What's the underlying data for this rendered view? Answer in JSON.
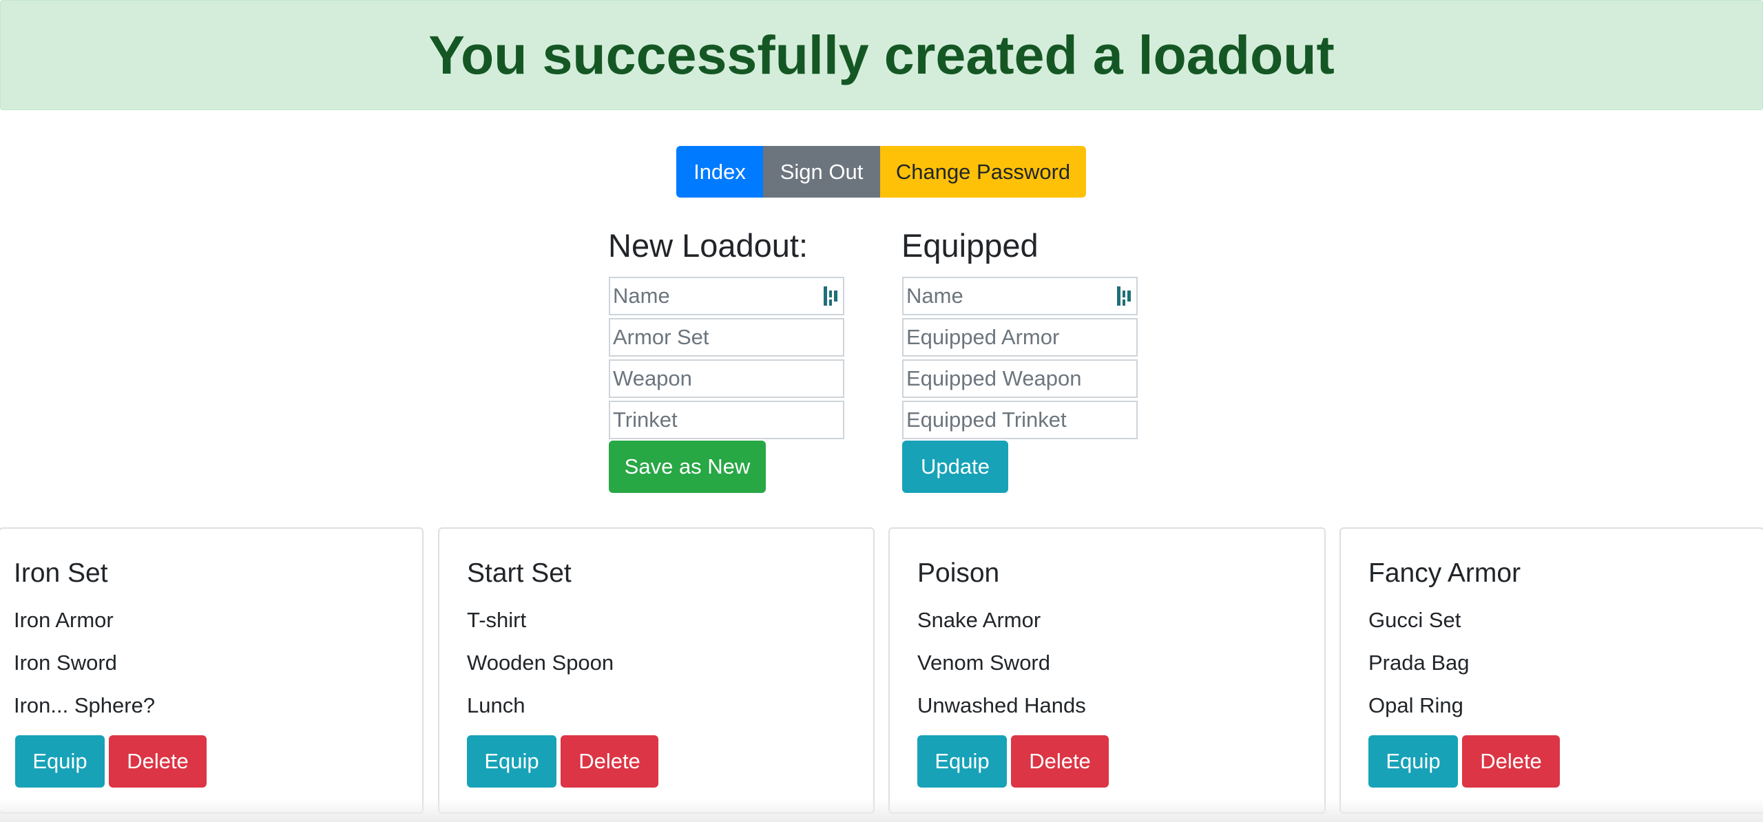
{
  "alert": {
    "message": "You successfully created a loadout",
    "color": "#155724",
    "background": "#d4edda"
  },
  "nav": {
    "index_label": "Index",
    "signout_label": "Sign Out",
    "change_password_label": "Change Password"
  },
  "new_loadout": {
    "heading": "New Loadout:",
    "name_placeholder": "Name",
    "armor_placeholder": "Armor Set",
    "weapon_placeholder": "Weapon",
    "trinket_placeholder": "Trinket",
    "save_label": "Save as New"
  },
  "equipped": {
    "heading": "Equipped",
    "name_placeholder": "Name",
    "armor_placeholder": "Equipped Armor",
    "weapon_placeholder": "Equipped Weapon",
    "trinket_placeholder": "Equipped Trinket",
    "update_label": "Update"
  },
  "loadouts": [
    {
      "title": "Iron Set",
      "armor": "Iron Armor",
      "weapon": "Iron Sword",
      "trinket": "Iron... Sphere?"
    },
    {
      "title": "Start Set",
      "armor": "T-shirt",
      "weapon": "Wooden Spoon",
      "trinket": "Lunch"
    },
    {
      "title": "Poison",
      "armor": "Snake Armor",
      "weapon": "Venom Sword",
      "trinket": "Unwashed Hands"
    },
    {
      "title": "Fancy Armor",
      "armor": "Gucci Set",
      "weapon": "Prada Bag",
      "trinket": "Opal Ring"
    }
  ],
  "card_buttons": {
    "equip_label": "Equip",
    "delete_label": "Delete"
  },
  "icons": {
    "password_manager": "password-manager-icon"
  }
}
